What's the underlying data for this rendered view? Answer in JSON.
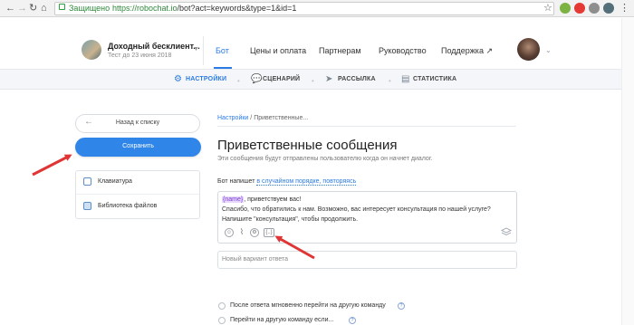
{
  "browser": {
    "secure_label": "Защищено",
    "url_domain": "https://robochat.io",
    "url_path": "/bot?act=keywords&type=1&id=1",
    "back_icon": "←",
    "forward_icon": "→",
    "reload_icon": "↻",
    "home_icon": "⌂",
    "star_icon": "☆"
  },
  "header": {
    "project_name": "Доходный бесклиент...",
    "project_sub": "Тест до 23 июня 2018",
    "nav": [
      "Бот",
      "Цены и оплата",
      "Партнерам",
      "Руководство",
      "Поддержка ↗"
    ]
  },
  "subnav": {
    "items": [
      "НАСТРОЙКИ",
      "СЦЕНАРИЙ",
      "РАССЫЛКА",
      "СТАТИСТИКА"
    ]
  },
  "sidebar": {
    "back_label": "Назад к списку",
    "save_label": "Сохранить",
    "items": [
      "Клавиатура",
      "Библиотека файлов"
    ]
  },
  "main": {
    "crumb_link": "Настройки",
    "crumb_current": "Приветственные...",
    "crumb_sep": "/",
    "title": "Приветственные сообщения",
    "description": "Эти сообщения будут отправлены пользователю когда он начнет диалог.",
    "bot_says_prefix": "Бот напишет",
    "bot_says_link": "в случайном порядке, повторяясь",
    "message_tag": "{name}",
    "message_line1_rest": ", приветствуем вас!",
    "message_line2": "Спасибо, что обратились к нам. Возможно, вас интересует консультация по нашей услуге?",
    "message_line3": "Напишите \"консультация\", чтобы продолжить.",
    "new_variant_placeholder": "Новый вариант ответа",
    "options": [
      "После ответа мгновенно перейти на другую команду",
      "Перейти на другую команду если..."
    ],
    "help_glyph": "?"
  },
  "colors": {
    "accent": "#2a7be4",
    "save_button": "#2f86e8",
    "arrow": "#e03535",
    "tag_bg": "#e6d7fb"
  }
}
